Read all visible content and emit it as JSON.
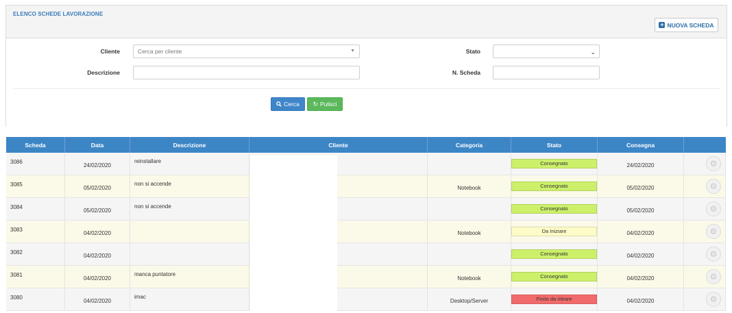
{
  "header": {
    "title": "ELENCO SCHEDE LAVORAZIONE",
    "new_button": "NUOVA SCHEDA"
  },
  "filters": {
    "cliente_label": "Cliente",
    "cliente_placeholder": "Cerca per cliente",
    "stato_label": "Stato",
    "stato_value": "",
    "descrizione_label": "Descrizione",
    "descrizione_value": "",
    "nscheda_label": "N. Scheda",
    "nscheda_value": ""
  },
  "buttons": {
    "search": "Cerca",
    "reset": "Pulisci"
  },
  "table": {
    "columns": [
      "Scheda",
      "Data",
      "Descrizione",
      "Cliente",
      "Categoria",
      "Stato",
      "Consegna",
      ""
    ],
    "rows": [
      {
        "scheda": "3086",
        "data": "24/02/2020",
        "descrizione": "reinstallare",
        "cliente": "",
        "categoria": "",
        "stato": "Consegnato",
        "stato_color": "#ccf06a",
        "consegna": "24/02/2020"
      },
      {
        "scheda": "3085",
        "data": "05/02/2020",
        "descrizione": "non si accende",
        "cliente": "",
        "categoria": "Notebook",
        "stato": "Consegnato",
        "stato_color": "#ccf06a",
        "consegna": "05/02/2020"
      },
      {
        "scheda": "3084",
        "data": "05/02/2020",
        "descrizione": "non si accende",
        "cliente": "",
        "categoria": "",
        "stato": "Consegnato",
        "stato_color": "#ccf06a",
        "consegna": "05/02/2020"
      },
      {
        "scheda": "3083",
        "data": "04/02/2020",
        "descrizione": "",
        "cliente": "",
        "categoria": "Notebook",
        "stato": "Da Iniziare",
        "stato_color": "#fdfbc7",
        "consegna": "04/02/2020"
      },
      {
        "scheda": "3082",
        "data": "04/02/2020",
        "descrizione": "",
        "cliente": "",
        "categoria": "",
        "stato": "Consegnato",
        "stato_color": "#ccf06a",
        "consegna": "04/02/2020"
      },
      {
        "scheda": "3081",
        "data": "04/02/2020",
        "descrizione": "manca puntatore",
        "cliente": "",
        "categoria": "Notebook",
        "stato": "Consegnato",
        "stato_color": "#ccf06a",
        "consegna": "04/02/2020"
      },
      {
        "scheda": "3080",
        "data": "04/02/2020",
        "descrizione": "imac",
        "cliente": "",
        "categoria": "Desktop/Server",
        "stato": "Finito da ritirare",
        "stato_color": "#f26b6b",
        "consegna": "04/02/2020"
      }
    ]
  },
  "colors": {
    "accent": "#3d86c6",
    "title": "#3a7ab8",
    "success": "#5cb85c",
    "primary": "#3f86c9"
  },
  "icons": {
    "new": "plus-square-icon",
    "search": "search-icon",
    "reset": "refresh-icon",
    "row_action": "gear-icon"
  }
}
